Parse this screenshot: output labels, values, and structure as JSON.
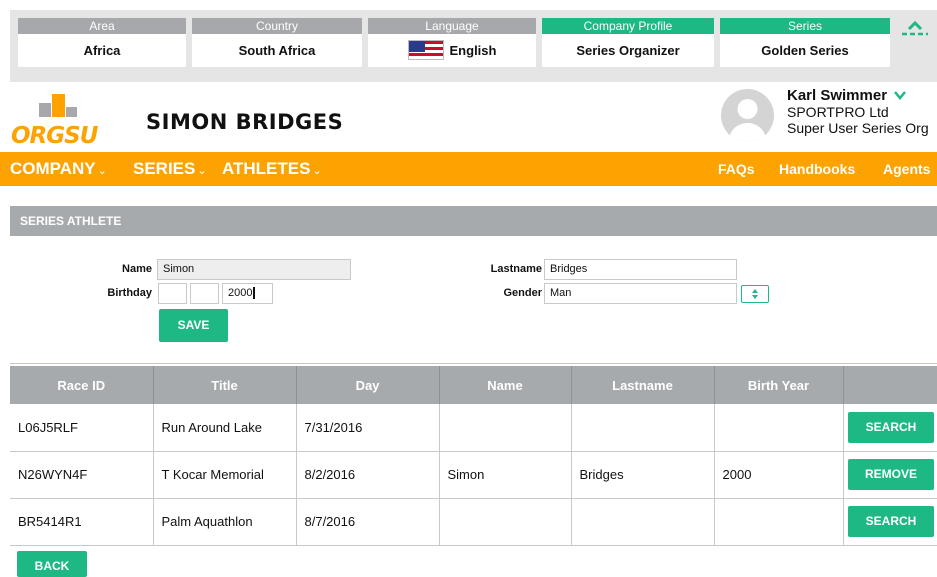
{
  "selectors": [
    {
      "header": "Area",
      "value": "Africa"
    },
    {
      "header": "Country",
      "value": "South Africa"
    },
    {
      "header": "Language",
      "value": "English"
    },
    {
      "header": "Company Profile",
      "value": "Series Organizer"
    },
    {
      "header": "Series",
      "value": "Golden Series"
    }
  ],
  "logo_text": "ORGSU",
  "athlete_title": "SIMON BRIDGES",
  "user": {
    "name": "Karl Swimmer",
    "company": "SPORTPRO Ltd",
    "role": "Super User Series Org"
  },
  "nav": {
    "company": "COMPANY",
    "series": "SERIES",
    "athletes": "ATHLETES",
    "caret": "⌄",
    "faqs": "FAQs",
    "handbooks": "Handbooks",
    "agents": "Agents"
  },
  "section_title": "SERIES ATHLETE",
  "form": {
    "name_label": "Name",
    "name_value": "Simon",
    "lastname_label": "Lastname",
    "lastname_value": "Bridges",
    "birthday_label": "Birthday",
    "birth_day": "",
    "birth_month": "",
    "birth_year": "2000",
    "gender_label": "Gender",
    "gender_value": "Man",
    "save_label": "SAVE"
  },
  "table": {
    "headers": [
      "Race ID",
      "Title",
      "Day",
      "Name",
      "Lastname",
      "Birth Year",
      ""
    ],
    "rows": [
      {
        "race_id": "L06J5RLF",
        "title": "Run Around Lake",
        "day": "7/31/2016",
        "name": "",
        "lastname": "",
        "birth_year": "",
        "action": "SEARCH"
      },
      {
        "race_id": "N26WYN4F",
        "title": "T Kocar Memorial",
        "day": "8/2/2016",
        "name": "Simon",
        "lastname": "Bridges",
        "birth_year": "2000",
        "action": "REMOVE"
      },
      {
        "race_id": "BR5414R1",
        "title": "Palm Aquathlon",
        "day": "8/7/2016",
        "name": "",
        "lastname": "",
        "birth_year": "",
        "action": "SEARCH"
      }
    ]
  },
  "back_label": "BACK",
  "colors": {
    "accent_green": "#1db884",
    "nav_orange": "#fca301",
    "header_grey": "#a6aaad"
  }
}
